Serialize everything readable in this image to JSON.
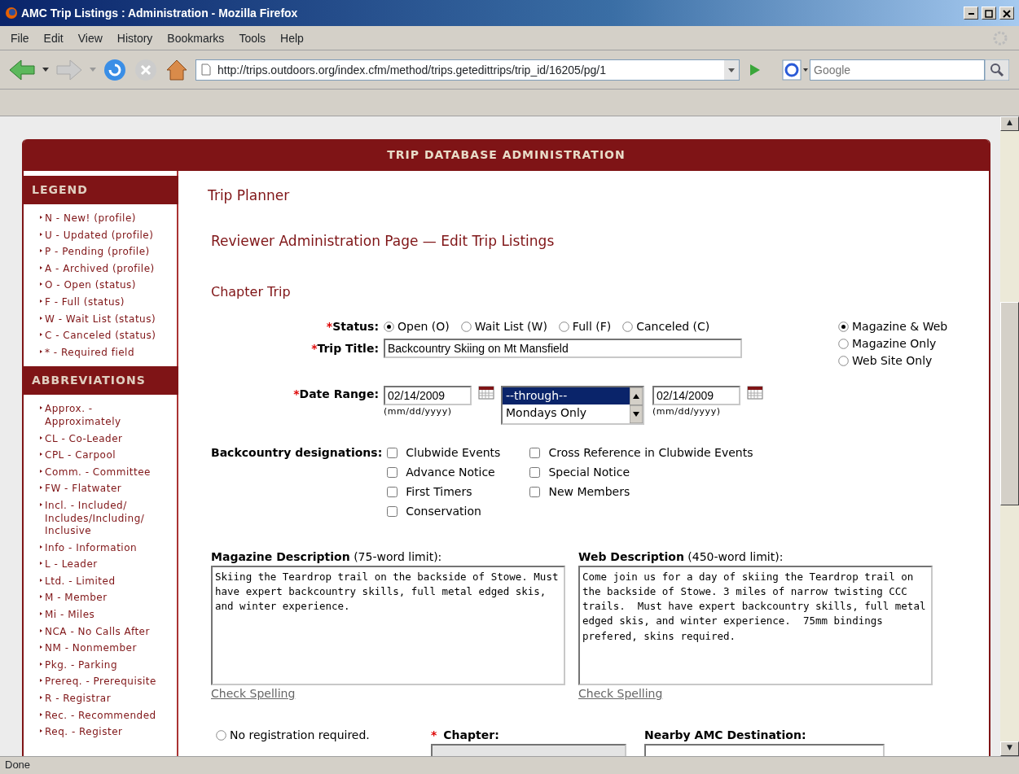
{
  "window": {
    "title": "AMC Trip Listings : Administration - Mozilla Firefox"
  },
  "menu": [
    "File",
    "Edit",
    "View",
    "History",
    "Bookmarks",
    "Tools",
    "Help"
  ],
  "address": {
    "url": "http://trips.outdoors.org/index.cfm/method/trips.getedittrips/trip_id/16205/pg/1"
  },
  "search": {
    "placeholder": "Google"
  },
  "banner": "TRIP DATABASE ADMINISTRATION",
  "sidebar": [
    {
      "heading": "LEGEND",
      "items": [
        "N - New! (profile)",
        "U - Updated (profile)",
        "P - Pending (profile)",
        "A - Archived (profile)",
        "O - Open (status)",
        "F - Full (status)",
        "W - Wait List (status)",
        "C - Canceled (status)",
        "* - Required field"
      ]
    },
    {
      "heading": "ABBREVIATIONS",
      "items": [
        "Approx. - Approximately",
        "CL - Co-Leader",
        "CPL - Carpool",
        "Comm. - Committee",
        "FW - Flatwater",
        "Incl. - Included/ Includes/Including/ Inclusive",
        "Info - Information",
        "L - Leader",
        "Ltd. - Limited",
        "M - Member",
        "Mi - Miles",
        "NCA - No Calls After",
        "NM - Nonmember",
        "Pkg. - Parking",
        "Prereq. - Prerequisite",
        "R - Registrar",
        "Rec. - Recommended",
        "Req. - Register"
      ]
    }
  ],
  "page_title": "Trip Planner",
  "subtitle": "Reviewer Administration Page — Edit Trip Listings",
  "section": "Chapter Trip",
  "status": {
    "required": "*",
    "label": "Status:",
    "options": [
      {
        "label": "Open (O)",
        "selected": true
      },
      {
        "label": "Wait List (W)",
        "selected": false
      },
      {
        "label": "Full (F)",
        "selected": false
      },
      {
        "label": "Canceled (C)",
        "selected": false
      }
    ]
  },
  "publish": [
    {
      "label": "Magazine & Web",
      "selected": true
    },
    {
      "label": "Magazine Only",
      "selected": false
    },
    {
      "label": "Web Site Only",
      "selected": false
    }
  ],
  "trip_title": {
    "required": "*",
    "label": "Trip Title:",
    "value": "Backcountry Skiing on Mt Mansfield"
  },
  "date_range": {
    "required": "*",
    "label": "Date Range:",
    "start": "02/14/2009",
    "end": "02/14/2009",
    "hint_start": "(mm/dd/yyyy)",
    "hint_end": "(mm/dd/yyyy)",
    "options": [
      {
        "label": "--through--",
        "selected": true
      },
      {
        "label": "Mondays Only",
        "selected": false
      }
    ]
  },
  "designations": {
    "label": "Backcountry designations:",
    "columns": [
      [
        {
          "label": "Clubwide Events",
          "checked": false
        },
        {
          "label": "Advance Notice",
          "checked": false
        },
        {
          "label": "First Timers",
          "checked": false
        },
        {
          "label": "Conservation",
          "checked": false
        }
      ],
      [
        {
          "label": "Cross Reference in Clubwide Events",
          "checked": false
        },
        {
          "label": "Special Notice",
          "checked": false
        },
        {
          "label": "New Members",
          "checked": false
        }
      ]
    ]
  },
  "descriptions": [
    {
      "label": "Magazine Description",
      "limit": "(75-word limit):",
      "value": "Skiing the Teardrop trail on the backside of Stowe. Must have expert backcountry skills, full metal edged skis, and winter experience.",
      "link": "Check Spelling"
    },
    {
      "label": "Web Description",
      "limit": "(450-word limit):",
      "value": "Come join us for a day of skiing the Teardrop trail on the backside of Stowe. 3 miles of narrow twisting CCC trails.  Must have expert backcountry skills, full metal edged skis, and winter experience.  75mm bindings prefered, skins required.",
      "link": "Check Spelling"
    }
  ],
  "registration": {
    "label": "No registration required.",
    "selected": false
  },
  "chapter": {
    "required": "*",
    "label": "Chapter:"
  },
  "destination": {
    "label": "Nearby AMC Destination:"
  },
  "scrollbar": {
    "up": "▲",
    "down": "▼"
  },
  "status_bar": "Done"
}
